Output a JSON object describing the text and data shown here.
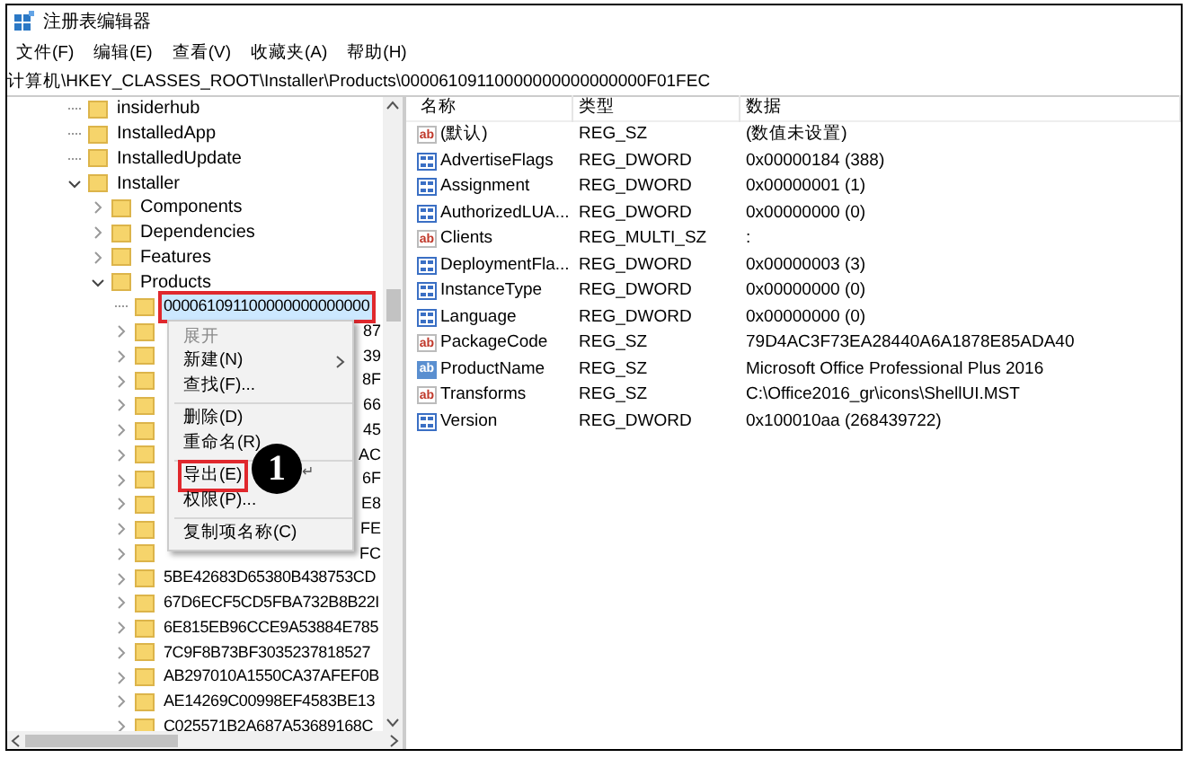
{
  "window": {
    "title": "注册表编辑器"
  },
  "menu": [
    "文件(F)",
    "编辑(E)",
    "查看(V)",
    "收藏夹(A)",
    "帮助(H)"
  ],
  "address": "计算机\\HKEY_CLASSES_ROOT\\Installer\\Products\\00006109110000000000000000F01FEC",
  "tree": [
    {
      "label": "insiderhub",
      "kind": "leaf"
    },
    {
      "label": "InstalledApp",
      "kind": "leaf"
    },
    {
      "label": "InstalledUpdate",
      "kind": "leaf"
    },
    {
      "label": "Installer",
      "kind": "node",
      "expanded": true,
      "children": [
        {
          "label": "Components",
          "kind": "node",
          "expanded": false
        },
        {
          "label": "Dependencies",
          "kind": "node",
          "expanded": false
        },
        {
          "label": "Features",
          "kind": "node",
          "expanded": false
        },
        {
          "label": "Products",
          "kind": "node",
          "expanded": true,
          "children": [
            {
              "label": "000061091100000000000000",
              "kind": "leaf",
              "selected": true,
              "covered": false
            },
            {
              "label": "87",
              "kind": "node",
              "expanded": false,
              "selected": false,
              "covered": true
            },
            {
              "label": "39",
              "kind": "node",
              "expanded": false,
              "selected": false,
              "covered": true
            },
            {
              "label": "8F",
              "kind": "node",
              "expanded": false,
              "selected": false,
              "covered": true
            },
            {
              "label": "66",
              "kind": "node",
              "expanded": false,
              "selected": false,
              "covered": true
            },
            {
              "label": "45",
              "kind": "node",
              "expanded": false,
              "selected": false,
              "covered": true
            },
            {
              "label": "AC",
              "kind": "node",
              "expanded": false,
              "selected": false,
              "covered": true
            },
            {
              "label": "6F",
              "kind": "node",
              "expanded": false,
              "selected": false,
              "covered": true
            },
            {
              "label": "E8",
              "kind": "node",
              "expanded": false,
              "selected": false,
              "covered": true
            },
            {
              "label": "FE",
              "kind": "node",
              "expanded": false,
              "selected": false,
              "covered": true
            },
            {
              "label": "FC",
              "kind": "node",
              "expanded": false,
              "selected": false,
              "covered": true
            },
            {
              "label": "5BE42683D65380B438753CD",
              "kind": "node",
              "expanded": false,
              "selected": false,
              "covered": false
            },
            {
              "label": "67D6ECF5CD5FBA732B8B22I",
              "kind": "node",
              "expanded": false,
              "selected": false,
              "covered": false
            },
            {
              "label": "6E815EB96CCE9A53884E785",
              "kind": "node",
              "expanded": false,
              "selected": false,
              "covered": false
            },
            {
              "label": "7C9F8B73BF3035237818527",
              "kind": "node",
              "expanded": false,
              "selected": false,
              "covered": false
            },
            {
              "label": "AB297010A1550CA37AFEF0B",
              "kind": "node",
              "expanded": false,
              "selected": false,
              "covered": false
            },
            {
              "label": "AE14269C00998EF4583BE13",
              "kind": "node",
              "expanded": false,
              "selected": false,
              "covered": false
            },
            {
              "label": "C025571B2A687A53689168C",
              "kind": "node",
              "expanded": false,
              "selected": false,
              "covered": false
            }
          ]
        }
      ]
    }
  ],
  "context_menu": [
    {
      "kind": "item",
      "label": "展开",
      "disabled": true,
      "submenu": false,
      "highlighted": false
    },
    {
      "kind": "item",
      "label": "新建(N)",
      "disabled": false,
      "submenu": true,
      "highlighted": false
    },
    {
      "kind": "item",
      "label": "查找(F)...",
      "disabled": false,
      "submenu": false,
      "highlighted": false
    },
    {
      "kind": "separator"
    },
    {
      "kind": "item",
      "label": "删除(D)",
      "disabled": false,
      "submenu": false,
      "highlighted": false
    },
    {
      "kind": "item",
      "label": "重命名(R)",
      "disabled": false,
      "submenu": false,
      "highlighted": false
    },
    {
      "kind": "separator"
    },
    {
      "kind": "item",
      "label": "导出(E)",
      "disabled": false,
      "submenu": false,
      "highlighted": true
    },
    {
      "kind": "item",
      "label": "权限(P)...",
      "disabled": false,
      "submenu": false,
      "highlighted": false
    },
    {
      "kind": "separator"
    },
    {
      "kind": "item",
      "label": "复制项名称(C)",
      "disabled": false,
      "submenu": false,
      "highlighted": false
    }
  ],
  "step_badge": {
    "number": "1",
    "mark": "↵"
  },
  "table": {
    "columns": [
      "名称",
      "类型",
      "数据"
    ],
    "rows": [
      {
        "kind": "string",
        "icon": "ab",
        "name": "(默认)",
        "type": "REG_SZ",
        "data": "(数值未设置)"
      },
      {
        "kind": "number",
        "name": "AdvertiseFlags",
        "type": "REG_DWORD",
        "data": "0x00000184 (388)"
      },
      {
        "kind": "number",
        "name": "Assignment",
        "type": "REG_DWORD",
        "data": "0x00000001 (1)"
      },
      {
        "kind": "number",
        "name": "AuthorizedLUA...",
        "type": "REG_DWORD",
        "data": "0x00000000 (0)"
      },
      {
        "kind": "string",
        "icon": "ab",
        "name": "Clients",
        "type": "REG_MULTI_SZ",
        "data": ":"
      },
      {
        "kind": "number",
        "name": "DeploymentFla...",
        "type": "REG_DWORD",
        "data": "0x00000003 (3)"
      },
      {
        "kind": "number",
        "name": "InstanceType",
        "type": "REG_DWORD",
        "data": "0x00000000 (0)"
      },
      {
        "kind": "number",
        "name": "Language",
        "type": "REG_DWORD",
        "data": "0x00000000 (0)"
      },
      {
        "kind": "string",
        "icon": "ab",
        "name": "PackageCode",
        "type": "REG_SZ",
        "data": "79D4AC3F73EA28440A6A1878E85ADA40"
      },
      {
        "kind": "focused",
        "icon": "ab",
        "name": "ProductName",
        "type": "REG_SZ",
        "data": "Microsoft Office Professional Plus 2016"
      },
      {
        "kind": "string",
        "icon": "ab",
        "name": "Transforms",
        "type": "REG_SZ",
        "data": "C:\\Office2016_gr\\icons\\ShellUI.MST"
      },
      {
        "kind": "number",
        "name": "Version",
        "type": "REG_DWORD",
        "data": "0x100010aa (268439722)"
      }
    ]
  }
}
